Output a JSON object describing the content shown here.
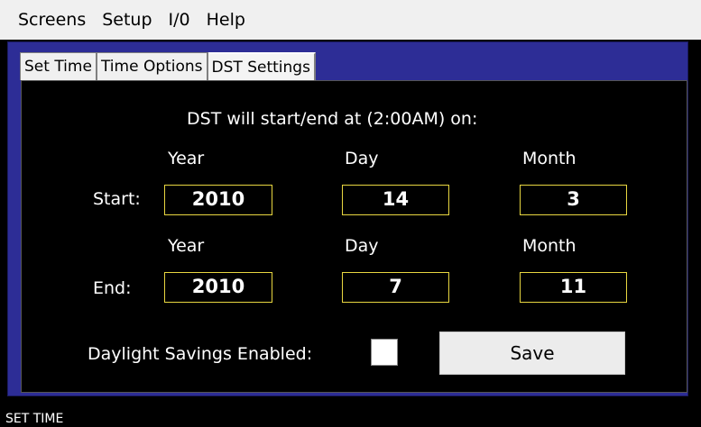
{
  "menu": {
    "items": [
      "Screens",
      "Setup",
      "I/0",
      "Help"
    ]
  },
  "tabs": [
    "Set Time",
    "Time Options",
    "DST Settings"
  ],
  "dst": {
    "heading": "DST will start/end at (2:00AM) on:",
    "col_year": "Year",
    "col_day": "Day",
    "col_month": "Month",
    "start_label": "Start:",
    "start": {
      "year": "2010",
      "day": "14",
      "month": "3"
    },
    "end_label": "End:",
    "end": {
      "year": "2010",
      "day": "7",
      "month": "11"
    },
    "enabled_label": "Daylight Savings Enabled:",
    "enabled": false,
    "save_label": "Save"
  },
  "status": {
    "text": "SET TIME"
  }
}
